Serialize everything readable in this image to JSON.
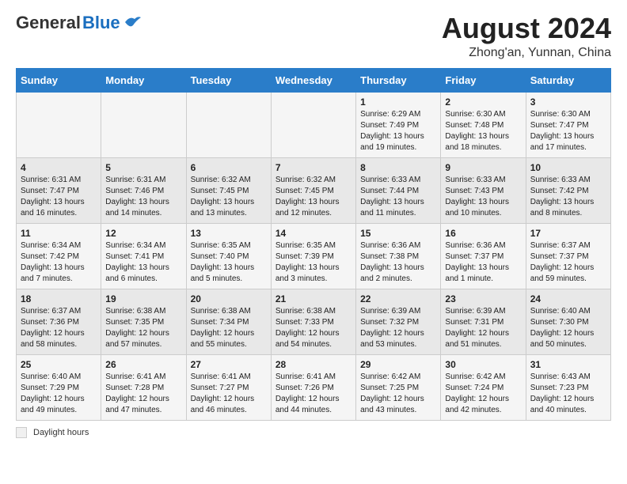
{
  "header": {
    "logo_general": "General",
    "logo_blue": "Blue",
    "month_year": "August 2024",
    "location": "Zhong'an, Yunnan, China"
  },
  "calendar": {
    "weekdays": [
      "Sunday",
      "Monday",
      "Tuesday",
      "Wednesday",
      "Thursday",
      "Friday",
      "Saturday"
    ],
    "weeks": [
      [
        {
          "day": "",
          "info": ""
        },
        {
          "day": "",
          "info": ""
        },
        {
          "day": "",
          "info": ""
        },
        {
          "day": "",
          "info": ""
        },
        {
          "day": "1",
          "info": "Sunrise: 6:29 AM\nSunset: 7:49 PM\nDaylight: 13 hours\nand 19 minutes."
        },
        {
          "day": "2",
          "info": "Sunrise: 6:30 AM\nSunset: 7:48 PM\nDaylight: 13 hours\nand 18 minutes."
        },
        {
          "day": "3",
          "info": "Sunrise: 6:30 AM\nSunset: 7:47 PM\nDaylight: 13 hours\nand 17 minutes."
        }
      ],
      [
        {
          "day": "4",
          "info": "Sunrise: 6:31 AM\nSunset: 7:47 PM\nDaylight: 13 hours\nand 16 minutes."
        },
        {
          "day": "5",
          "info": "Sunrise: 6:31 AM\nSunset: 7:46 PM\nDaylight: 13 hours\nand 14 minutes."
        },
        {
          "day": "6",
          "info": "Sunrise: 6:32 AM\nSunset: 7:45 PM\nDaylight: 13 hours\nand 13 minutes."
        },
        {
          "day": "7",
          "info": "Sunrise: 6:32 AM\nSunset: 7:45 PM\nDaylight: 13 hours\nand 12 minutes."
        },
        {
          "day": "8",
          "info": "Sunrise: 6:33 AM\nSunset: 7:44 PM\nDaylight: 13 hours\nand 11 minutes."
        },
        {
          "day": "9",
          "info": "Sunrise: 6:33 AM\nSunset: 7:43 PM\nDaylight: 13 hours\nand 10 minutes."
        },
        {
          "day": "10",
          "info": "Sunrise: 6:33 AM\nSunset: 7:42 PM\nDaylight: 13 hours\nand 8 minutes."
        }
      ],
      [
        {
          "day": "11",
          "info": "Sunrise: 6:34 AM\nSunset: 7:42 PM\nDaylight: 13 hours\nand 7 minutes."
        },
        {
          "day": "12",
          "info": "Sunrise: 6:34 AM\nSunset: 7:41 PM\nDaylight: 13 hours\nand 6 minutes."
        },
        {
          "day": "13",
          "info": "Sunrise: 6:35 AM\nSunset: 7:40 PM\nDaylight: 13 hours\nand 5 minutes."
        },
        {
          "day": "14",
          "info": "Sunrise: 6:35 AM\nSunset: 7:39 PM\nDaylight: 13 hours\nand 3 minutes."
        },
        {
          "day": "15",
          "info": "Sunrise: 6:36 AM\nSunset: 7:38 PM\nDaylight: 13 hours\nand 2 minutes."
        },
        {
          "day": "16",
          "info": "Sunrise: 6:36 AM\nSunset: 7:37 PM\nDaylight: 13 hours\nand 1 minute."
        },
        {
          "day": "17",
          "info": "Sunrise: 6:37 AM\nSunset: 7:37 PM\nDaylight: 12 hours\nand 59 minutes."
        }
      ],
      [
        {
          "day": "18",
          "info": "Sunrise: 6:37 AM\nSunset: 7:36 PM\nDaylight: 12 hours\nand 58 minutes."
        },
        {
          "day": "19",
          "info": "Sunrise: 6:38 AM\nSunset: 7:35 PM\nDaylight: 12 hours\nand 57 minutes."
        },
        {
          "day": "20",
          "info": "Sunrise: 6:38 AM\nSunset: 7:34 PM\nDaylight: 12 hours\nand 55 minutes."
        },
        {
          "day": "21",
          "info": "Sunrise: 6:38 AM\nSunset: 7:33 PM\nDaylight: 12 hours\nand 54 minutes."
        },
        {
          "day": "22",
          "info": "Sunrise: 6:39 AM\nSunset: 7:32 PM\nDaylight: 12 hours\nand 53 minutes."
        },
        {
          "day": "23",
          "info": "Sunrise: 6:39 AM\nSunset: 7:31 PM\nDaylight: 12 hours\nand 51 minutes."
        },
        {
          "day": "24",
          "info": "Sunrise: 6:40 AM\nSunset: 7:30 PM\nDaylight: 12 hours\nand 50 minutes."
        }
      ],
      [
        {
          "day": "25",
          "info": "Sunrise: 6:40 AM\nSunset: 7:29 PM\nDaylight: 12 hours\nand 49 minutes."
        },
        {
          "day": "26",
          "info": "Sunrise: 6:41 AM\nSunset: 7:28 PM\nDaylight: 12 hours\nand 47 minutes."
        },
        {
          "day": "27",
          "info": "Sunrise: 6:41 AM\nSunset: 7:27 PM\nDaylight: 12 hours\nand 46 minutes."
        },
        {
          "day": "28",
          "info": "Sunrise: 6:41 AM\nSunset: 7:26 PM\nDaylight: 12 hours\nand 44 minutes."
        },
        {
          "day": "29",
          "info": "Sunrise: 6:42 AM\nSunset: 7:25 PM\nDaylight: 12 hours\nand 43 minutes."
        },
        {
          "day": "30",
          "info": "Sunrise: 6:42 AM\nSunset: 7:24 PM\nDaylight: 12 hours\nand 42 minutes."
        },
        {
          "day": "31",
          "info": "Sunrise: 6:43 AM\nSunset: 7:23 PM\nDaylight: 12 hours\nand 40 minutes."
        }
      ]
    ]
  },
  "legend": {
    "text": "Daylight hours"
  }
}
